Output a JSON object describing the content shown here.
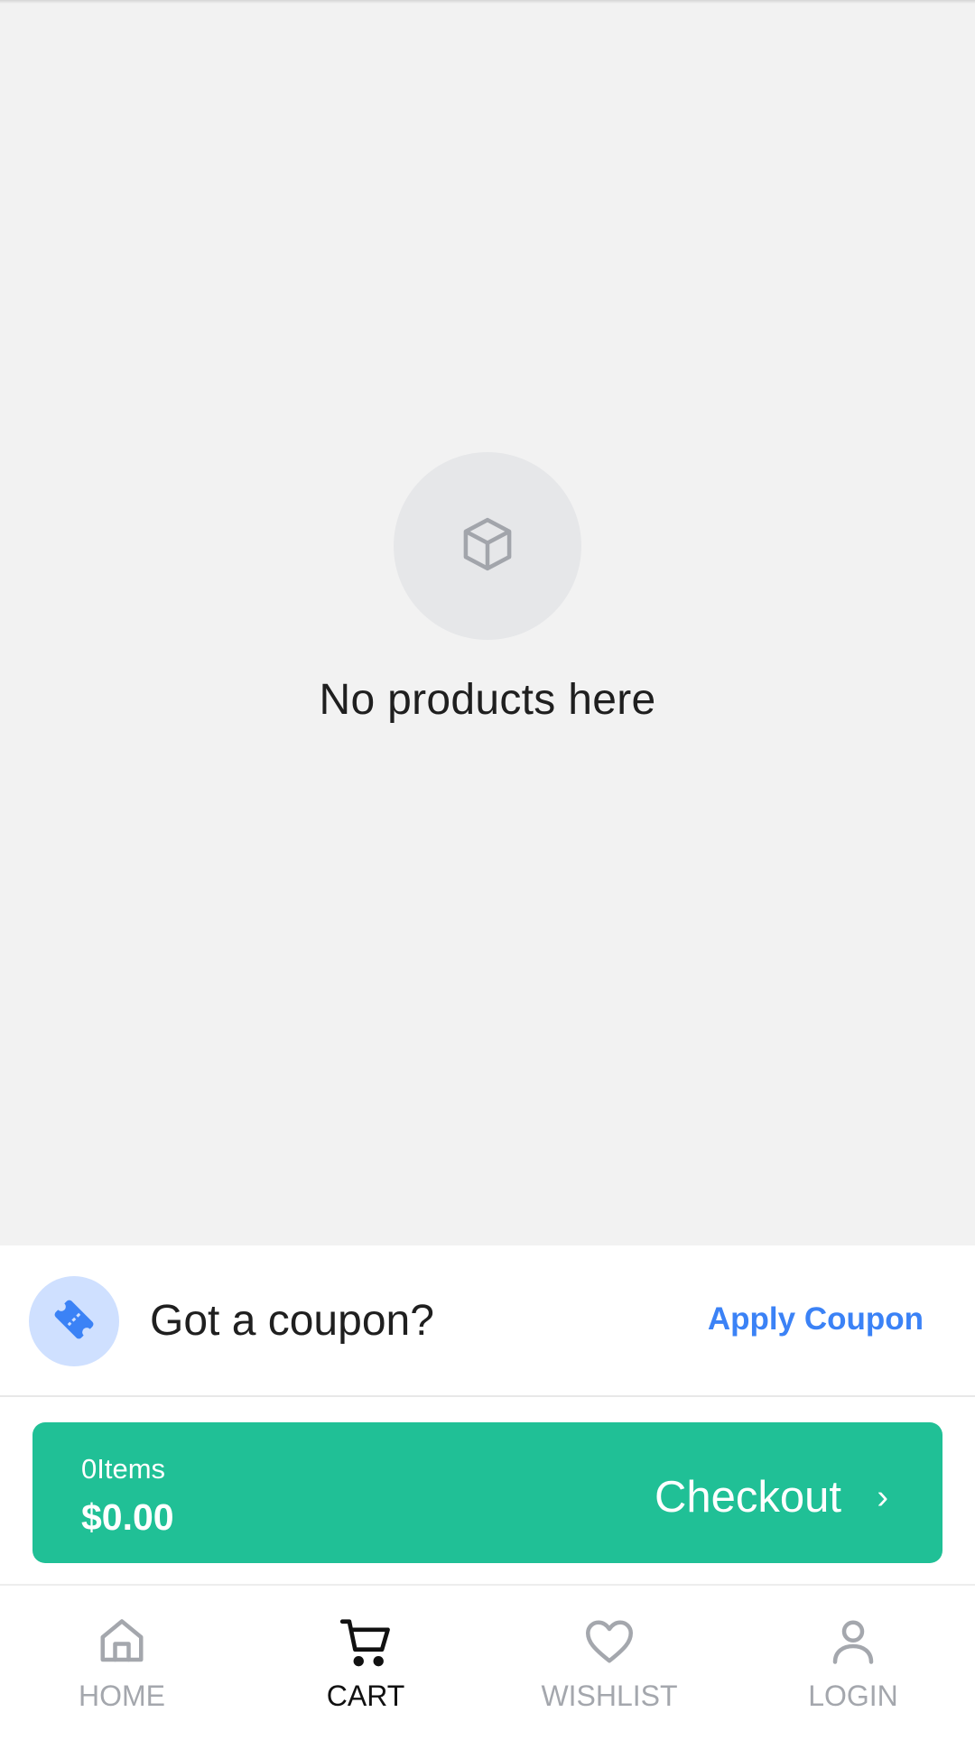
{
  "empty_state": {
    "icon": "box-icon",
    "message": "No products here"
  },
  "coupon": {
    "icon": "coupon-ticket-icon",
    "prompt": "Got a coupon?",
    "action_label": "Apply Coupon"
  },
  "checkout": {
    "item_count_label": "0Items",
    "total": "$0.00",
    "label": "Checkout",
    "chevron": "›"
  },
  "nav": {
    "items": [
      {
        "label": "HOME",
        "icon": "home-icon",
        "active": false
      },
      {
        "label": "CART",
        "icon": "cart-icon",
        "active": true
      },
      {
        "label": "WISHLIST",
        "icon": "heart-icon",
        "active": false
      },
      {
        "label": "LOGIN",
        "icon": "user-icon",
        "active": false
      }
    ]
  },
  "colors": {
    "accent": "#20c096",
    "link": "#3b82f6",
    "background": "#f2f2f2"
  }
}
